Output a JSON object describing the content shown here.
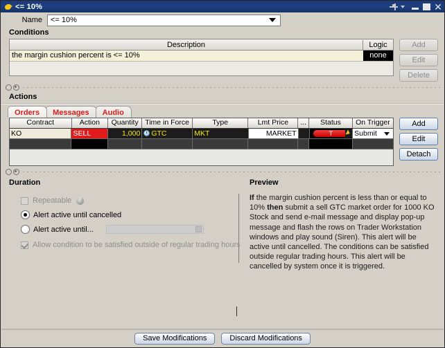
{
  "window": {
    "title": "<= 10%",
    "icon": "bird-icon",
    "controls": {
      "pin": "pin-icon",
      "pin_dropdown": "chevron-down-icon",
      "minimize": "minimize-icon",
      "maximize": "maximize-icon",
      "close": "close-icon"
    }
  },
  "name_field": {
    "label": "Name",
    "value": "<= 10%",
    "dropdown_icon": "chevron-down-icon"
  },
  "conditions": {
    "section_title": "Conditions",
    "columns": [
      "Description",
      "Logic"
    ],
    "rows": [
      {
        "description": "the margin cushion percent is <= 10%",
        "logic": "none"
      }
    ],
    "buttons": [
      {
        "label": "Add",
        "enabled": false
      },
      {
        "label": "Edit",
        "enabled": false
      },
      {
        "label": "Delete",
        "enabled": false
      }
    ]
  },
  "actions": {
    "section_title": "Actions",
    "tabs": [
      {
        "label": "Orders",
        "active": true
      },
      {
        "label": "Messages",
        "active": false
      },
      {
        "label": "Audio",
        "active": false
      }
    ],
    "columns": [
      "Contract",
      "Action",
      "Quantity",
      "Time in Force",
      "Type",
      "Lmt Price",
      "...",
      "Status",
      "On Trigger"
    ],
    "rows": [
      {
        "contract": "KO",
        "action": "SELL",
        "quantity": "1,000",
        "time_in_force": "GTC",
        "tif_icon": "clock-icon",
        "type": "MKT",
        "lmt_price": "MARKET",
        "dots": "",
        "status": "T",
        "status_icon": "cursor-icon",
        "on_trigger": "Submit",
        "on_trigger_icon": "chevron-down-icon"
      }
    ],
    "buttons": [
      {
        "label": "Add",
        "enabled": true
      },
      {
        "label": "Edit",
        "enabled": true
      },
      {
        "label": "Detach",
        "enabled": true
      }
    ]
  },
  "duration": {
    "section_title": "Duration",
    "repeatable": {
      "label": "Repeatable",
      "checked": false,
      "enabled": false,
      "help_icon": "help-icon"
    },
    "option_until_cancelled": {
      "label": "Alert active until cancelled",
      "selected": true
    },
    "option_until_date": {
      "label": "Alert active until...",
      "selected": false,
      "date_value": "",
      "calendar_icon": "calendar-icon"
    },
    "allow_outside_rth": {
      "label": "Allow condition to be satisfied outside of regular trading hours",
      "checked": true,
      "enabled": false
    }
  },
  "preview": {
    "section_title": "Preview",
    "segments": [
      {
        "text": "If",
        "bold": true
      },
      {
        "text": " the margin cushion percent is less than or equal to 10% ",
        "bold": false
      },
      {
        "text": "then",
        "bold": true
      },
      {
        "text": " submit a sell GTC market order for 1000 KO Stock and send e-mail message and display pop-up message and flash the rows on Trader Workstation windows and play sound (Siren). This alert will be active until cancelled. The conditions can be satisfied outside regular trading hours. This alert will be cancelled by system once it is triggered.",
        "bold": false
      }
    ],
    "full_text": "If the margin cushion percent is less than or equal to 10% then submit a sell GTC market order for 1000 KO Stock and send e-mail message and display pop-up message and flash the rows on Trader Workstation windows and play sound (Siren). This alert will be active until cancelled. The conditions can be satisfied outside regular trading hours. This alert will be cancelled by system once it is triggered."
  },
  "footer": {
    "save_label": "Save Modifications",
    "discard_label": "Discard Modifications"
  },
  "colors": {
    "titlebar": "#1d3f80",
    "sell_red": "#e01b1b",
    "tab_text_red": "#cf2020",
    "quantity_yellow": "#f2e900",
    "condition_row": "#f5f0d8",
    "contract_cell": "#efeada"
  }
}
